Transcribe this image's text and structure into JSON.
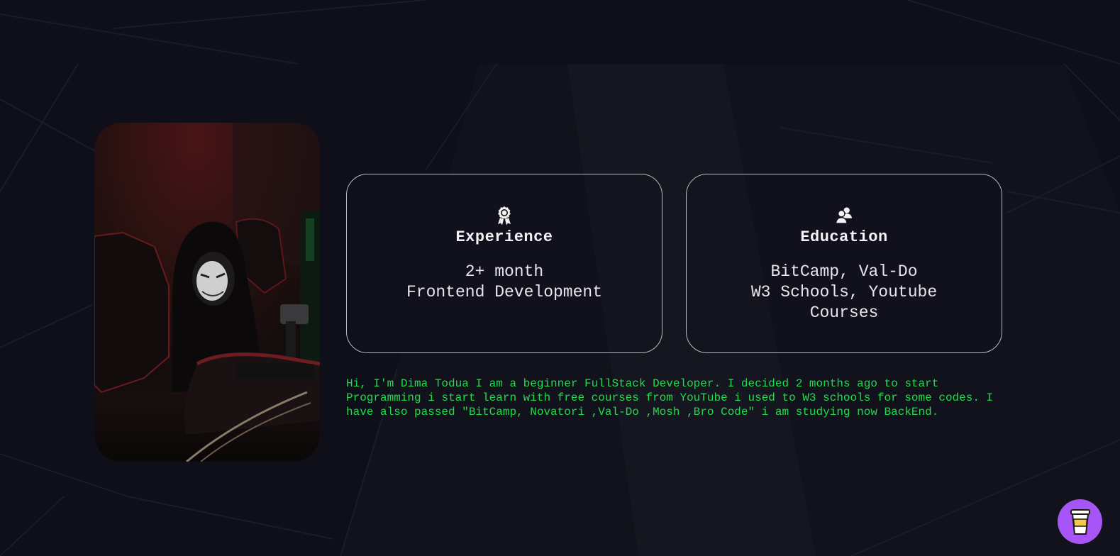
{
  "portrait": {
    "alt": "Hooded figure in a mask at a computer desk"
  },
  "cards": [
    {
      "icon": "award-icon",
      "title": "Experience",
      "lines": [
        "2+ month",
        "Frontend Development"
      ]
    },
    {
      "icon": "users-icon",
      "title": "Education",
      "lines": [
        "BitCamp, Val-Do",
        "W3 Schools, Youtube",
        "Courses"
      ]
    }
  ],
  "bio": "Hi, I'm Dima Todua I am a beginner FullStack Developer. I decided 2 months ago to start Programming i start learn with free courses from YouTube i used to W3 schools for some codes. I have also passed \"BitCamp, Novatori ,Val-Do ,Mosh ,Bro Code\" i am studying now BackEnd.",
  "coffee_button": {
    "icon": "coffee-cup-icon"
  },
  "colors": {
    "background": "#0f0f1a",
    "bio_text": "#1fdd4a",
    "card_border": "#b9b9c2",
    "coffee_button": "#a855f7"
  }
}
